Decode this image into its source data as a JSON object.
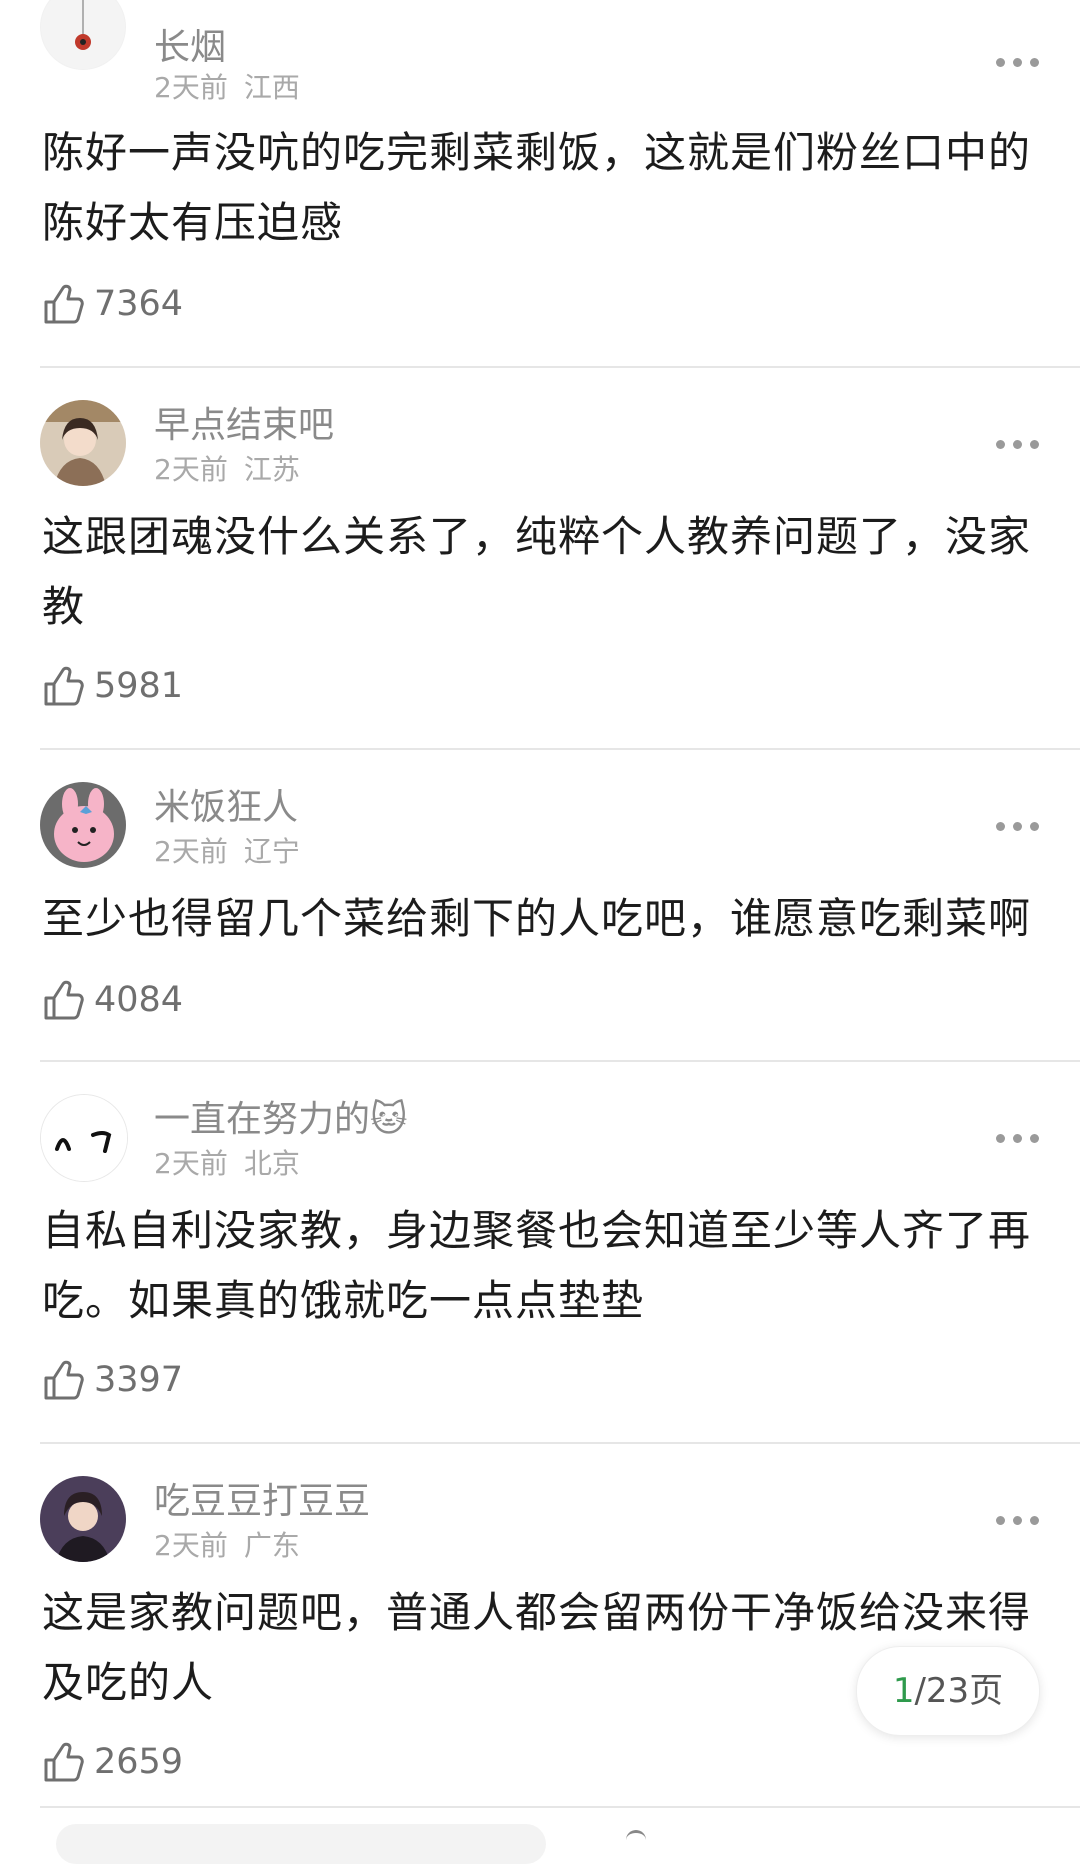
{
  "comments": [
    {
      "username": "长烟",
      "time": "2天前",
      "location": "江西",
      "text": "陈好一声没吭的吃完剩菜剩饭，这就是们粉丝口中的陈好太有压迫感",
      "likes": "7364",
      "avatar_icon": "spider-ornament-avatar"
    },
    {
      "username": "早点结束吧",
      "time": "2天前",
      "location": "江苏",
      "text": "这跟团魂没什么关系了，纯粹个人教养问题了，没家教",
      "likes": "5981",
      "avatar_icon": "girl-photo-avatar"
    },
    {
      "username": "米饭狂人",
      "time": "2天前",
      "location": "辽宁",
      "text": "至少也得留几个菜给剩下的人吃吧，谁愿意吃剩菜啊",
      "likes": "4084",
      "avatar_icon": "pink-rabbit-avatar"
    },
    {
      "username": "一直在努力的🐱",
      "time": "2天前",
      "location": "北京",
      "text": "自私自利没家教，身边聚餐也会知道至少等人齐了再吃。如果真的饿就吃一点点垫垫",
      "likes": "3397",
      "avatar_icon": "cat-eyes-avatar"
    },
    {
      "username": "吃豆豆打豆豆",
      "time": "2天前",
      "location": "广东",
      "text": "这是家教问题吧，普通人都会留两份干净饭给没来得及吃的人",
      "likes": "2659",
      "avatar_icon": "portrait-photo-avatar"
    }
  ],
  "pager": {
    "current": "1",
    "rest": "/23页"
  },
  "colors": {
    "accent_green": "#2e9a4c",
    "meta_gray": "#a9a9a9",
    "divider": "#e6e6e6"
  }
}
